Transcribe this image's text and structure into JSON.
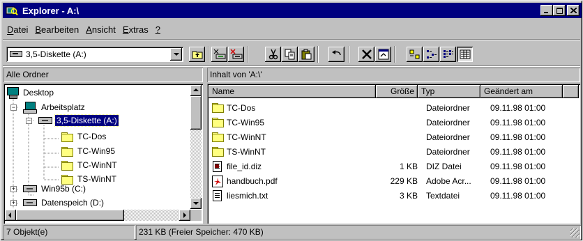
{
  "window": {
    "title": "Explorer - A:\\",
    "minimize": "_",
    "maximize": "□",
    "close": "✕"
  },
  "menu": [
    "Datei",
    "Bearbeiten",
    "Ansicht",
    "Extras",
    "?"
  ],
  "menu_mnemonics": [
    "D",
    "B",
    "A",
    "E",
    "?"
  ],
  "toolbar": {
    "address": "3,5-Diskette (A:)",
    "buttons": [
      "up-folder",
      "map-drive",
      "disconnect-drive",
      "cut",
      "copy",
      "paste",
      "undo",
      "delete",
      "properties",
      "large-icons",
      "small-icons",
      "list",
      "details"
    ]
  },
  "tree_pane": {
    "header": "Alle Ordner",
    "items": [
      {
        "label": "Desktop",
        "icon": "desktop-icon"
      },
      {
        "label": "Arbeitsplatz",
        "icon": "computer-icon",
        "expander": "−"
      },
      {
        "label": "3,5-Diskette (A:)",
        "icon": "floppy-drive-icon",
        "expander": "−",
        "selected": true
      },
      {
        "label": "TC-Dos",
        "icon": "folder-icon"
      },
      {
        "label": "TC-Win95",
        "icon": "folder-icon"
      },
      {
        "label": "TC-WinNT",
        "icon": "folder-icon"
      },
      {
        "label": "TS-WinNT",
        "icon": "folder-icon"
      },
      {
        "label": "Win95b (C:)",
        "icon": "hard-drive-icon",
        "expander": "+"
      },
      {
        "label": "Datenspeich (D:)",
        "icon": "hard-drive-icon",
        "expander": "+"
      }
    ]
  },
  "file_pane": {
    "header": "Inhalt von 'A:\\'",
    "columns": [
      "Name",
      "Größe",
      "Typ",
      "Geändert am"
    ],
    "rows": [
      {
        "name": "TC-Dos",
        "size": "",
        "type": "Dateiordner",
        "modified": "09.11.98 01:00",
        "icon": "folder-icon"
      },
      {
        "name": "TC-Win95",
        "size": "",
        "type": "Dateiordner",
        "modified": "09.11.98 01:00",
        "icon": "folder-icon"
      },
      {
        "name": "TC-WinNT",
        "size": "",
        "type": "Dateiordner",
        "modified": "09.11.98 01:00",
        "icon": "folder-icon"
      },
      {
        "name": "TS-WinNT",
        "size": "",
        "type": "Dateiordner",
        "modified": "09.11.98 01:00",
        "icon": "folder-icon"
      },
      {
        "name": "file_id.diz",
        "size": "1 KB",
        "type": "DIZ Datei",
        "modified": "09.11.98 01:00",
        "icon": "diz-file-icon"
      },
      {
        "name": "handbuch.pdf",
        "size": "229 KB",
        "type": "Adobe Acr...",
        "modified": "09.11.98 01:00",
        "icon": "pdf-file-icon"
      },
      {
        "name": "liesmich.txt",
        "size": "3 KB",
        "type": "Textdatei",
        "modified": "09.11.98 01:00",
        "icon": "text-file-icon"
      }
    ]
  },
  "status": {
    "objects": "7 Objekt(e)",
    "free_space": "231 KB (Freier Speicher: 470 KB)"
  }
}
